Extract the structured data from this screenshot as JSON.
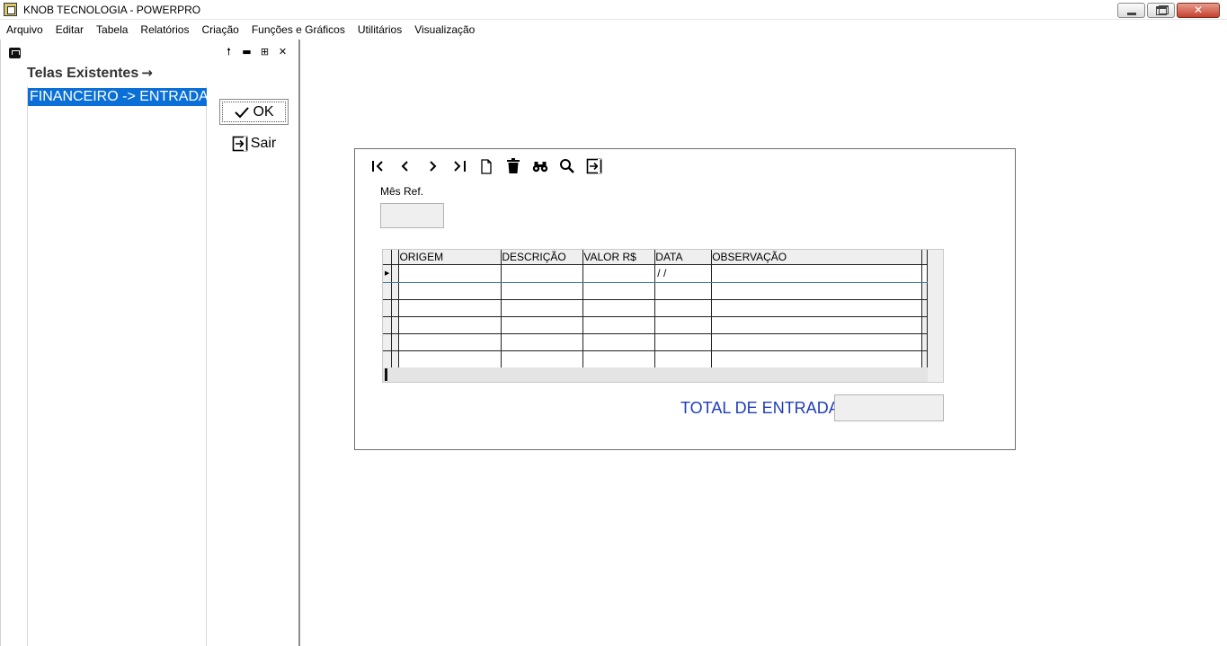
{
  "window": {
    "title": "KNOB TECNOLOGIA - POWERPRO",
    "close_glyph": "✕"
  },
  "menu": [
    "Arquivo",
    "Editar",
    "Tabela",
    "Relatórios",
    "Criação",
    "Funções e Gráficos",
    "Utilitários",
    "Visualização"
  ],
  "left_panel": {
    "heading": "Telas Existentes",
    "heading_arrow": "→",
    "items": [
      "FINANCEIRO -> ENTRADAS"
    ],
    "ok_label": "OK",
    "sair_label": "Sair",
    "tool_glyphs": [
      "🠕",
      "▬",
      "⊞",
      "✕"
    ]
  },
  "form": {
    "mes_ref_label": "Mês Ref.",
    "mes_ref_value": "",
    "grid": {
      "columns": [
        "ORIGEM",
        "DESCRIÇÃO",
        "VALOR R$",
        "DATA",
        "OBSERVAÇÃO"
      ],
      "current_row_marker": "▶",
      "date_placeholder": "/  /"
    },
    "total_label": "TOTAL DE ENTRADAS:",
    "total_value": ""
  },
  "colors": {
    "selection": "#0a6fd6",
    "total_label": "#1f3cb8"
  }
}
